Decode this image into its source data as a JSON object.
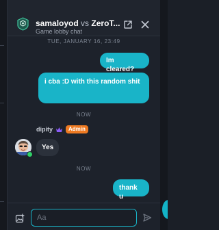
{
  "header": {
    "player_one": "samaloyod",
    "vs_label": "vs",
    "player_two": "ZeroT...",
    "subtitle": "Game lobby chat"
  },
  "messages": [
    {
      "type": "timestamp",
      "text": "TUE, JANUARY 16, 23:49"
    },
    {
      "type": "outgoing",
      "text": "Im cleared?"
    },
    {
      "type": "outgoing",
      "text": "i cba :D with this random shit"
    },
    {
      "type": "timestamp",
      "text": "NOW"
    },
    {
      "type": "incoming",
      "sender": "dipity",
      "badge": "Admin",
      "text": "Yes"
    },
    {
      "type": "timestamp",
      "text": "NOW"
    },
    {
      "type": "outgoing",
      "text": "thank u"
    }
  ],
  "input": {
    "placeholder": "Aa",
    "value": ""
  },
  "icons": {
    "game_logo": "game-logo-icon",
    "popout": "external-link-icon",
    "close": "close-icon",
    "crown": "crown-icon",
    "image_upload": "image-icon",
    "send": "send-icon"
  },
  "colors": {
    "accent": "#19b4c8",
    "admin_badge": "#ee7a22",
    "online": "#2fd167",
    "crown": "#8a5cf6",
    "background": "#1d222b"
  }
}
